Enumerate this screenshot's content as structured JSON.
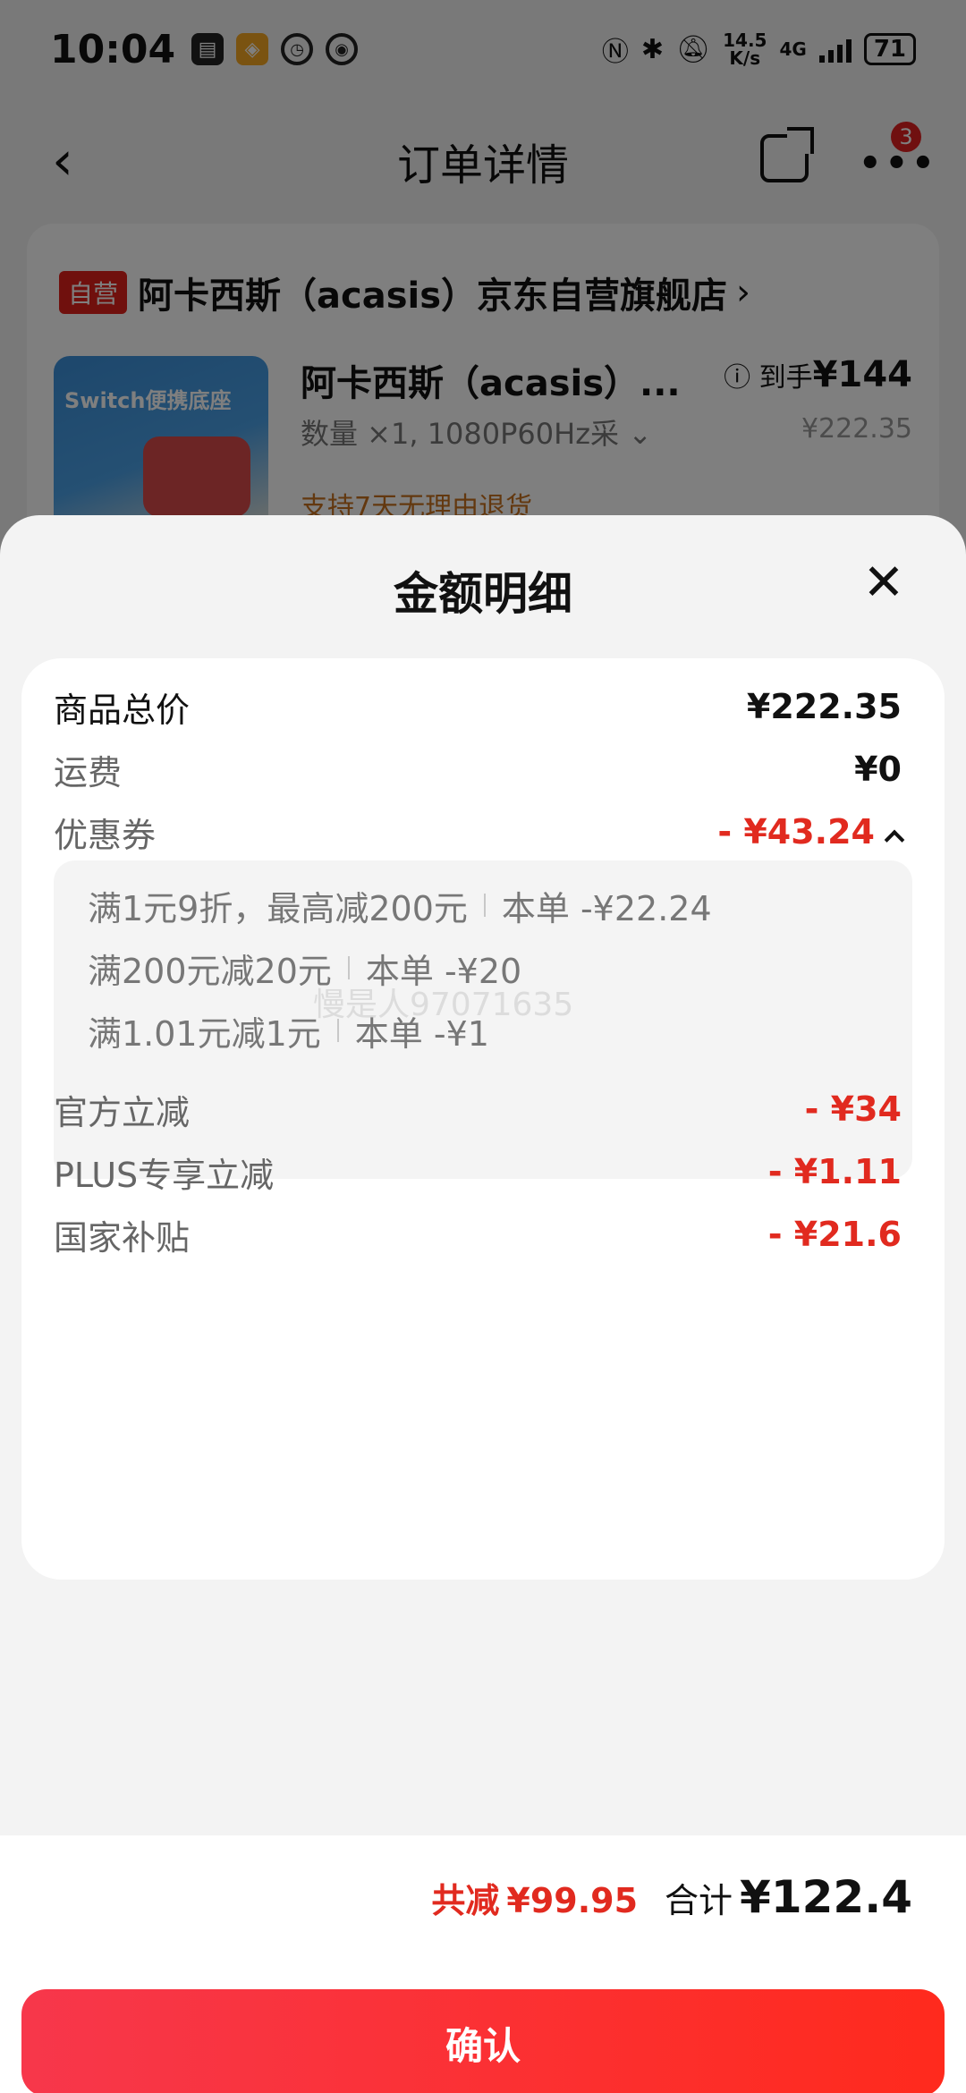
{
  "status_bar": {
    "time": "10:04",
    "app_icons": [
      "note-app-icon",
      "wallet-app-icon",
      "clock-app-icon",
      "eye-icon"
    ],
    "network_speed": "14.5\nK/s",
    "network_type": "4G",
    "battery": "71"
  },
  "nav": {
    "title": "订单详情",
    "badge_count": "3"
  },
  "shop": {
    "tag": "自营",
    "name": "阿卡西斯（acasis）京东自营旗舰店",
    "product": {
      "image_text": "Switch便携底座",
      "name": "阿卡西斯（acasis）...",
      "price_label": "到手",
      "price": "¥144",
      "original_price": "¥222.35",
      "spec": "数量 ×1, 1080P60Hz采",
      "return_policy": "支持7天无理由退货"
    }
  },
  "sheet": {
    "title": "金额明细",
    "rows": {
      "subtotal": {
        "label": "商品总价",
        "value": "¥222.35"
      },
      "shipping": {
        "label": "运费",
        "value": "¥0"
      },
      "coupon": {
        "label": "优惠券",
        "value": "- ¥43.24"
      },
      "official": {
        "label": "官方立减",
        "value": "- ¥34"
      },
      "plus": {
        "label": "PLUS专享立减",
        "value": "- ¥1.11"
      },
      "subsidy": {
        "label": "国家补贴",
        "value": "- ¥21.6"
      }
    },
    "coupons": [
      {
        "condition": "满1元9折，最高减200元",
        "amount": "本单 -¥22.24"
      },
      {
        "condition": "满200元减20元",
        "amount": "本单 -¥20"
      },
      {
        "condition": "满1.01元减1元",
        "amount": "本单 -¥1"
      }
    ],
    "watermark": "慢是人97071635"
  },
  "footer": {
    "reduce_label": "共减",
    "reduce_value": "¥99.95",
    "total_label": "合计",
    "total_value": "¥122.4",
    "confirm_label": "确认"
  },
  "colors": {
    "accent_red": "#e12a1f",
    "button_gradient_start": "#f7374b",
    "button_gradient_end": "#ff2a1d"
  }
}
